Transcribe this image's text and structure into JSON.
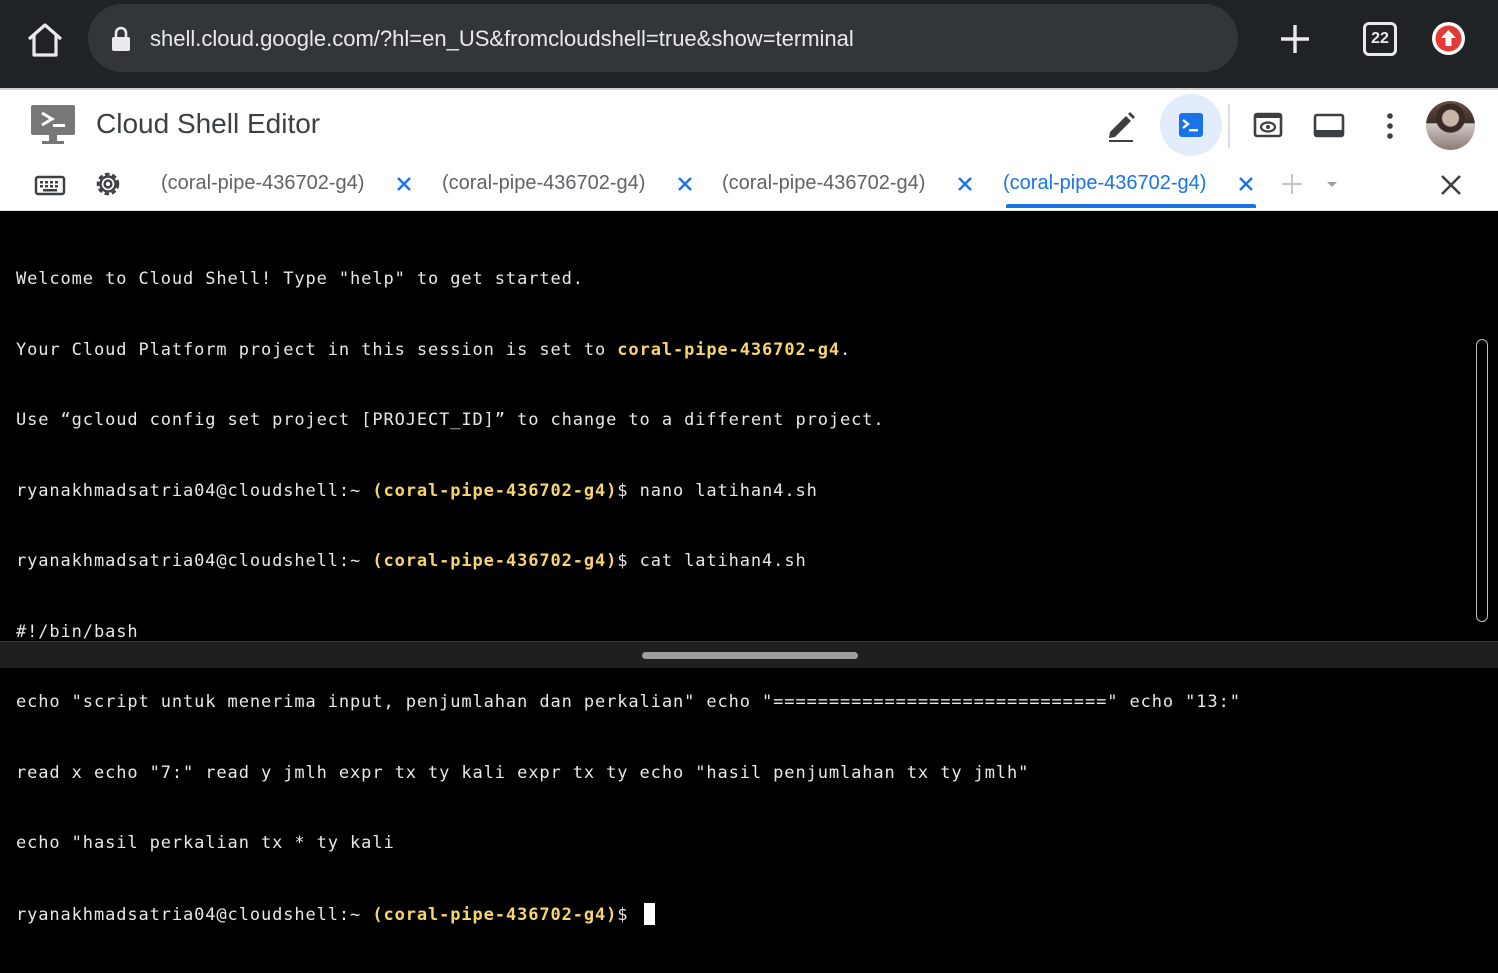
{
  "browser": {
    "url": "shell.cloud.google.com/?hl=en_US&fromcloudshell=true&show=terminal",
    "tab_count": "22"
  },
  "header": {
    "title": "Cloud Shell Editor"
  },
  "tabs": [
    {
      "label": "(coral-pipe-436702-g4)",
      "active": false
    },
    {
      "label": "(coral-pipe-436702-g4)",
      "active": false
    },
    {
      "label": "(coral-pipe-436702-g4)",
      "active": false
    },
    {
      "label": "(coral-pipe-436702-g4)",
      "active": true
    }
  ],
  "terminal": {
    "line1": "Welcome to Cloud Shell! Type \"help\" to get started.",
    "line2_prefix": "Your Cloud Platform project in this session is set to ",
    "line2_project": "coral-pipe-436702-g4",
    "line2_suffix": ".",
    "line3": "Use “gcloud config set project [PROJECT_ID]” to change to a different project.",
    "prompt_user": "ryanakhmadsatria04@cloudshell:~ ",
    "prompt_project": "(coral-pipe-436702-g4)",
    "cmd1": "$ nano latihan4.sh",
    "cmd2": "$ cat latihan4.sh",
    "out1": "#!/bin/bash",
    "out2": "echo \"script untuk menerima input, penjumlahan dan perkalian\" echo \"==============================\" echo \"13:\"",
    "out3": "read x echo \"7:\" read y jmlh expr tx ty kali expr tx ty echo \"hasil penjumlahan tx ty jmlh\"",
    "out4": "echo \"hasil perkalian tx * ty kali",
    "cmd3": "$ "
  },
  "colors": {
    "accent": "#1a73e8",
    "project_highlight": "#f7d56f",
    "terminal_bg": "#000000"
  }
}
